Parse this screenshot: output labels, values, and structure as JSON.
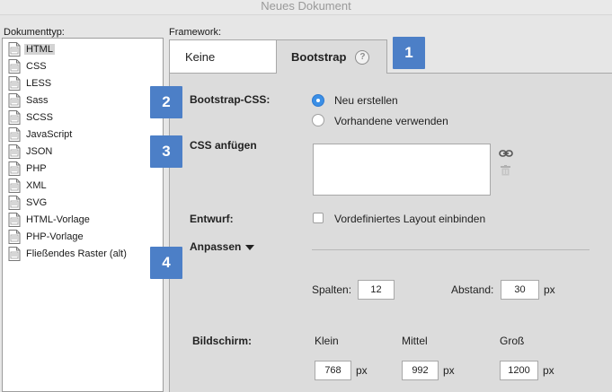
{
  "window": {
    "title": "Neues Dokument"
  },
  "left": {
    "label": "Dokumenttyp:",
    "items": [
      {
        "label": "HTML",
        "selected": true
      },
      {
        "label": "CSS"
      },
      {
        "label": "LESS"
      },
      {
        "label": "Sass"
      },
      {
        "label": "SCSS"
      },
      {
        "label": "JavaScript"
      },
      {
        "label": "JSON"
      },
      {
        "label": "PHP"
      },
      {
        "label": "XML"
      },
      {
        "label": "SVG"
      },
      {
        "label": "HTML-Vorlage"
      },
      {
        "label": "PHP-Vorlage"
      },
      {
        "label": "Fließendes Raster (alt)"
      }
    ]
  },
  "framework": {
    "label": "Framework:",
    "tabs": [
      {
        "label": "Keine"
      },
      {
        "label": "Bootstrap",
        "active": true
      }
    ],
    "help_icon": "?"
  },
  "badges": [
    "1",
    "2",
    "3",
    "4"
  ],
  "bootstrap_css": {
    "label": "Bootstrap-CSS:",
    "options": [
      {
        "label": "Neu erstellen",
        "checked": true
      },
      {
        "label": "Vorhandene verwenden",
        "checked": false
      }
    ]
  },
  "attach_css": {
    "label": "CSS anfügen"
  },
  "layout": {
    "label": "Entwurf:",
    "checkbox_label": "Vordefiniertes Layout einbinden",
    "checked": false
  },
  "customize": {
    "label": "Anpassen",
    "columns_label": "Spalten:",
    "columns_value": "12",
    "gutter_label": "Abstand:",
    "gutter_value": "30",
    "gutter_unit": "px"
  },
  "screen": {
    "label": "Bildschirm:",
    "sizes": [
      {
        "label": "Klein",
        "value": "768",
        "unit": "px"
      },
      {
        "label": "Mittel",
        "value": "992",
        "unit": "px"
      },
      {
        "label": "Groß",
        "value": "1200",
        "unit": "px"
      }
    ]
  },
  "colors": {
    "badge": "#4c7fc7",
    "radio_on": "#3b8fe6"
  }
}
